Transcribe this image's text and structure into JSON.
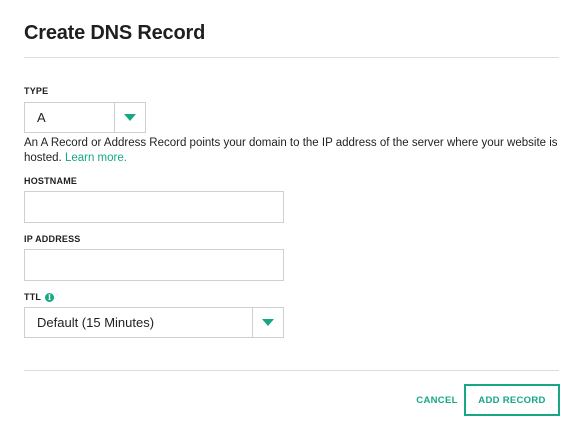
{
  "dialog": {
    "title": "Create DNS Record"
  },
  "type_field": {
    "label": "TYPE",
    "value": "A",
    "description": "An A Record or Address Record points your domain to the IP address of the server where your website is hosted.",
    "learn_more": "Learn more."
  },
  "hostname_field": {
    "label": "HOSTNAME",
    "value": "",
    "placeholder": ""
  },
  "ip_field": {
    "label": "IP ADDRESS",
    "value": "",
    "placeholder": ""
  },
  "ttl_field": {
    "label": "TTL",
    "info_icon": "info-icon",
    "value": "Default (15 Minutes)"
  },
  "actions": {
    "cancel": "CANCEL",
    "add_record": "ADD RECORD"
  },
  "colors": {
    "accent": "#15a883",
    "border": "#cfcfcf",
    "text": "#1f1f1f"
  }
}
